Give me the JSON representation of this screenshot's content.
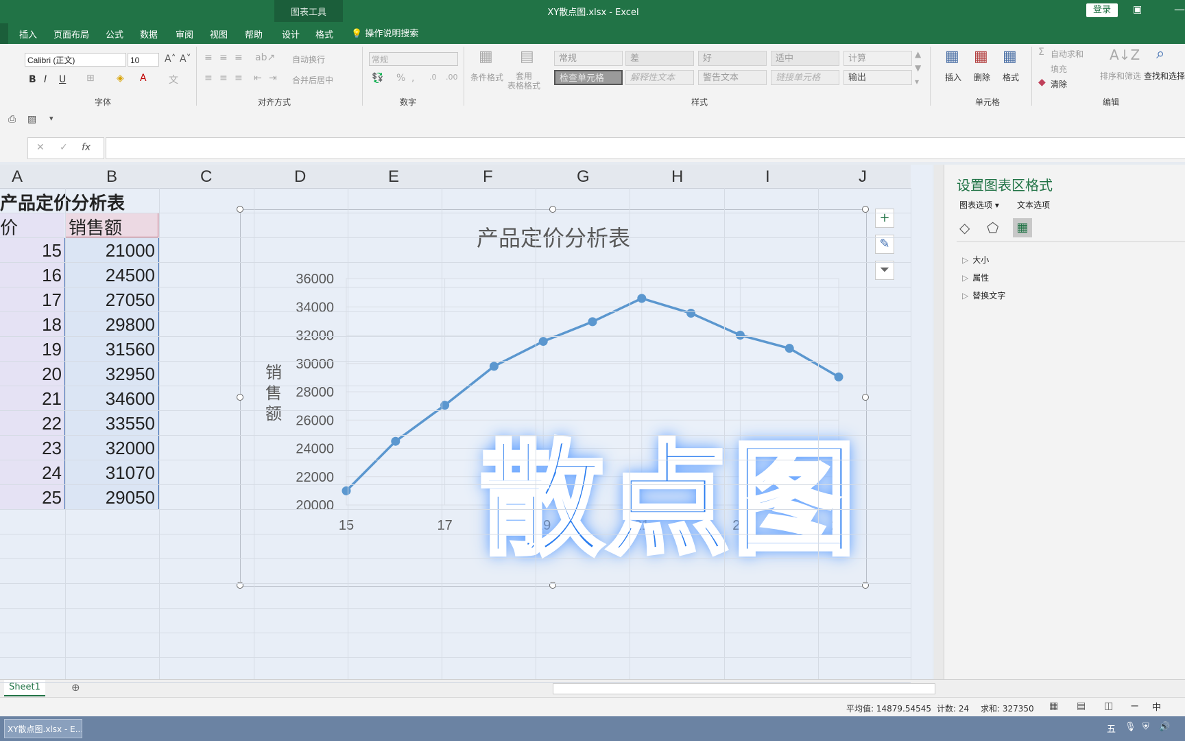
{
  "window": {
    "chart_tools_label": "图表工具",
    "title": "XY散点图.xlsx  -  Excel",
    "login": "登录"
  },
  "tabs": [
    "插入",
    "页面布局",
    "公式",
    "数据",
    "审阅",
    "视图",
    "帮助",
    "设计",
    "格式"
  ],
  "tell_me": "操作说明搜索",
  "ribbon": {
    "font_name": "Calibri (正文)",
    "font_size": "10",
    "font_group": "字体",
    "align_group": "对齐方式",
    "number_group": "数字",
    "styles_group": "样式",
    "cells_group": "单元格",
    "edit_group": "编辑",
    "wrap_text": "自动换行",
    "merge_center": "合并后居中",
    "number_format": "常规",
    "cond_format": "条件格式",
    "table_format": "套用\n表格格式",
    "styles": [
      {
        "label": "常规",
        "bg": "#ededed",
        "fg": "#9b9b9b"
      },
      {
        "label": "差",
        "bg": "#e6e6e6",
        "fg": "#9b9b9b"
      },
      {
        "label": "好",
        "bg": "#e6e6e6",
        "fg": "#9b9b9b"
      },
      {
        "label": "适中",
        "bg": "#e6e6e6",
        "fg": "#9b9b9b"
      },
      {
        "label": "计算",
        "bg": "#f0f0f0",
        "fg": "#9b9b9b"
      },
      {
        "label": "检查单元格",
        "bg": "#9a9a9a",
        "fg": "#e8e8e8"
      },
      {
        "label": "解释性文本",
        "bg": "#ededed",
        "fg": "#b0b0b0"
      },
      {
        "label": "警告文本",
        "bg": "#ededed",
        "fg": "#9b9b9b"
      },
      {
        "label": "链接单元格",
        "bg": "#ededed",
        "fg": "#b0b0b0"
      },
      {
        "label": "输出",
        "bg": "#f0f0f0",
        "fg": "#555555"
      }
    ],
    "insert": "插入",
    "delete": "删除",
    "format": "格式",
    "autosum": "自动求和",
    "fill": "填充",
    "clear": "清除",
    "sort_filter": "排序和筛选",
    "find_select": "查找和选择"
  },
  "formula_bar": {
    "cancel": "✕",
    "enter": "✓",
    "fx": "fx",
    "value": ""
  },
  "columns": [
    "A",
    "B",
    "C",
    "D",
    "E",
    "F",
    "G",
    "H",
    "I",
    "J"
  ],
  "sheet": {
    "title": "产品定价分析表",
    "header_a": "价",
    "header_b": "销售额",
    "rows": [
      {
        "a": "15",
        "b": "21000"
      },
      {
        "a": "16",
        "b": "24500"
      },
      {
        "a": "17",
        "b": "27050"
      },
      {
        "a": "18",
        "b": "29800"
      },
      {
        "a": "19",
        "b": "31560"
      },
      {
        "a": "20",
        "b": "32950"
      },
      {
        "a": "21",
        "b": "34600"
      },
      {
        "a": "22",
        "b": "33550"
      },
      {
        "a": "23",
        "b": "32000"
      },
      {
        "a": "24",
        "b": "31070"
      },
      {
        "a": "25",
        "b": "29050"
      }
    ]
  },
  "chart_data": {
    "type": "scatter",
    "title": "产品定价分析表",
    "ylabel": "销\n售\n额",
    "xlabel": "",
    "x": [
      15,
      16,
      17,
      18,
      19,
      20,
      21,
      22,
      23,
      24,
      25
    ],
    "y": [
      21000,
      24500,
      27050,
      29800,
      31560,
      32950,
      34600,
      33550,
      32000,
      31070,
      29050
    ],
    "xlim": [
      15,
      25
    ],
    "ylim": [
      20000,
      36000
    ],
    "x_ticks": [
      "15",
      "17",
      "19",
      "21",
      "23",
      "25"
    ],
    "y_ticks": [
      "36000",
      "34000",
      "32000",
      "30000",
      "28000",
      "26000",
      "24000",
      "22000",
      "20000"
    ],
    "grid": true,
    "line_color": "#5b97cf"
  },
  "overlay_text": "散点图",
  "pane": {
    "title": "设置图表区格式",
    "tab_chart_options": "图表选项",
    "tab_text_options": "文本选项",
    "sections": [
      "大小",
      "属性",
      "替换文字"
    ]
  },
  "sheet_tabs": [
    "Sheet1"
  ],
  "status": {
    "average": "平均值: 14879.54545",
    "count": "计数: 24",
    "sum": "求和: 327350"
  },
  "taskbar": {
    "app": "XY散点图.xlsx - E...",
    "ime": "五",
    "lang": "中"
  }
}
